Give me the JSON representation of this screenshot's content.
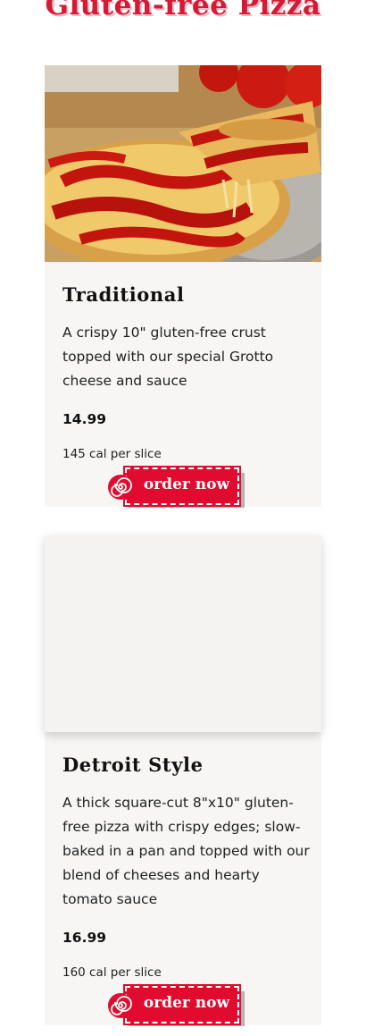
{
  "page": {
    "title": "Gluten-free Pizza"
  },
  "colors": {
    "brand_red": "#e00b2e",
    "title_red": "#d41a34",
    "card_bg": "#f7f6f5"
  },
  "menu_items": [
    {
      "name": "Traditional",
      "description": "A crispy 10\" gluten-free crust topped with our special Grotto cheese and sauce",
      "price": "14.99",
      "calories": "145 cal per slice",
      "order_label": "order now",
      "icon": "swirl-icon"
    },
    {
      "name": "Detroit Style",
      "description": "A thick square-cut 8\"x10\" gluten-free pizza with crispy edges; slow-baked in a pan and topped with our blend of cheeses and hearty tomato sauce",
      "price": "16.99",
      "calories": "160 cal per slice",
      "order_label": "order now",
      "icon": "swirl-icon"
    }
  ]
}
